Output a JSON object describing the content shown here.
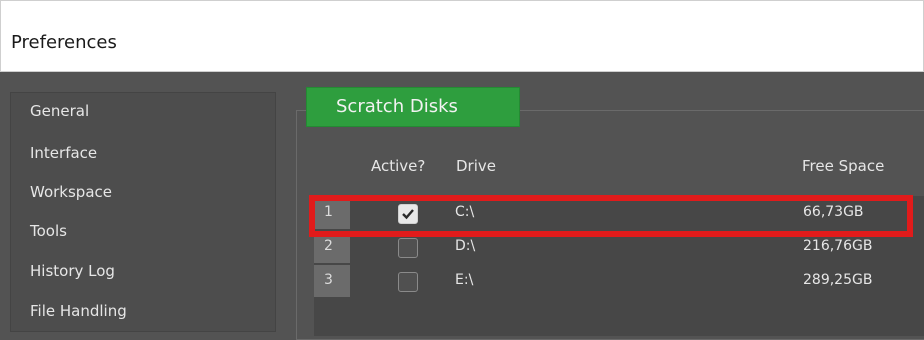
{
  "window": {
    "title": "Preferences"
  },
  "sidebar": {
    "items": [
      {
        "label": "General"
      },
      {
        "label": "Interface"
      },
      {
        "label": "Workspace"
      },
      {
        "label": "Tools"
      },
      {
        "label": "History Log"
      },
      {
        "label": "File Handling"
      }
    ]
  },
  "scratch_disks": {
    "title": "Scratch Disks",
    "columns": {
      "active": "Active?",
      "drive": "Drive",
      "free_space": "Free Space"
    },
    "rows": [
      {
        "num": "1",
        "active": true,
        "drive": "C:\\",
        "free_space": "66,73GB",
        "highlighted": true
      },
      {
        "num": "2",
        "active": false,
        "drive": "D:\\",
        "free_space": "216,76GB",
        "highlighted": false
      },
      {
        "num": "3",
        "active": false,
        "drive": "E:\\",
        "free_space": "289,25GB",
        "highlighted": false
      }
    ]
  },
  "colors": {
    "panel_bg": "#535353",
    "section_header_green": "#2e9e3e",
    "highlight_red": "#e11b1b"
  },
  "icons": {
    "checkbox_checked": "checkmark-icon"
  }
}
